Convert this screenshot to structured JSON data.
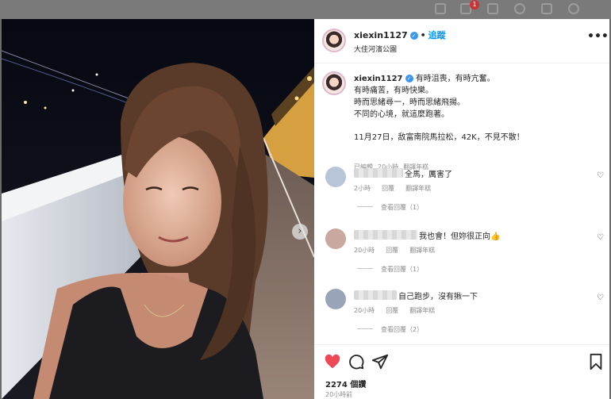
{
  "post": {
    "username": "xiexin1127",
    "follow_label": "追蹤",
    "location": "大佳河濱公園",
    "more_label": "•••",
    "verified_mark": "✓"
  },
  "caption": {
    "username": "xiexin1127",
    "lines": [
      "有時沮喪，有時亢奮。",
      "有時痛苦，有時快樂。",
      "時而思緒尋一，時而思緒飛揚。",
      "不同的心境，就這麼跑著。",
      "11月27日，敌富南院馬拉松，42K，不見不散！"
    ],
    "meta": [
      "已編輯",
      "20小時",
      "翻譯年糕"
    ]
  },
  "comments": [
    {
      "text": "全馬，厲害了",
      "time": "2小時",
      "reply": "回覆",
      "translate": "翻譯年糕",
      "view_replies": "查看回覆（1）",
      "avatar_color": "#b8c4d8"
    },
    {
      "text": "我也會！但妳很正向👍",
      "time": "20小時",
      "reply": "回覆",
      "translate": "翻譯年糕",
      "view_replies": "查看回覆（1）",
      "avatar_color": "#c9a8a0"
    },
    {
      "text": "自己跑步，沒有揪一下",
      "time": "20小時",
      "reply": "回覆",
      "translate": "翻譯年糕",
      "view_replies": "查看回覆（2）",
      "avatar_color": "#9aa4b8"
    }
  ],
  "footer": {
    "likes": "2274 個讚",
    "time_ago": "20小時前"
  },
  "icons": {
    "heart": "heart-filled-icon",
    "comment": "comment-icon",
    "share": "share-icon",
    "save": "bookmark-icon",
    "next": "chevron-right-icon",
    "like_small": "heart-outline-icon"
  },
  "colors": {
    "accent": "#0095f6",
    "like": "#ed4956",
    "verified": "#3897f0",
    "muted": "#8e8e8e"
  },
  "backdrop": {
    "notification_count": "1"
  }
}
